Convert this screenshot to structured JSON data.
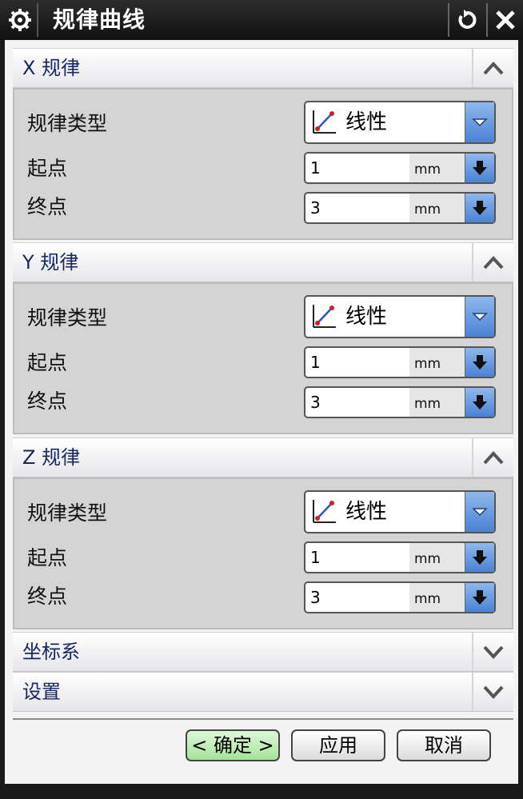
{
  "window": {
    "title": "规律曲线",
    "settings_icon": "gear-icon",
    "reset_icon": "reset-icon",
    "close_icon": "close-icon"
  },
  "sections": {
    "x": {
      "title": "X 规律",
      "law_type_label": "规律类型",
      "law_type_value": "线性",
      "start_label": "起点",
      "start_value": "1",
      "start_unit": "mm",
      "end_label": "终点",
      "end_value": "3",
      "end_unit": "mm"
    },
    "y": {
      "title": "Y 规律",
      "law_type_label": "规律类型",
      "law_type_value": "线性",
      "start_label": "起点",
      "start_value": "1",
      "start_unit": "mm",
      "end_label": "终点",
      "end_value": "3",
      "end_unit": "mm"
    },
    "z": {
      "title": "Z 规律",
      "law_type_label": "规律类型",
      "law_type_value": "线性",
      "start_label": "起点",
      "start_value": "1",
      "start_unit": "mm",
      "end_label": "终点",
      "end_value": "3",
      "end_unit": "mm"
    },
    "csys": {
      "title": "坐标系"
    },
    "settings": {
      "title": "设置"
    }
  },
  "buttons": {
    "ok": "< 确定 >",
    "apply": "应用",
    "cancel": "取消"
  },
  "colors": {
    "section_title": "#152860",
    "dropdown_blue": "#4a82d4",
    "ok_green": "#a5e39a"
  }
}
